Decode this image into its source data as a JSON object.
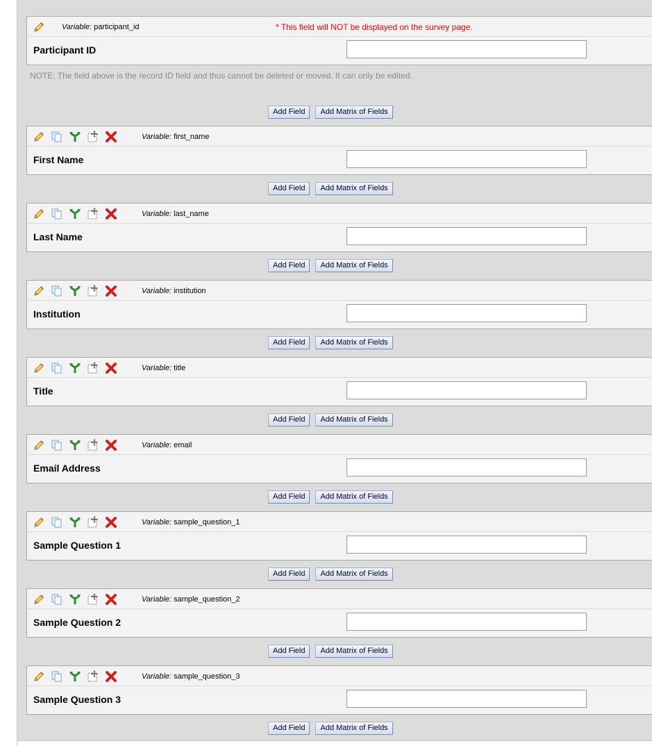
{
  "record_id_field": {
    "variable_prefix": "Variable:",
    "variable_name": "participant_id",
    "warning": "* This field will NOT be displayed on the survey page.",
    "label": "Participant ID",
    "value": ""
  },
  "note": "NOTE: The field above is the record ID field and thus cannot be deleted or moved. It can only be edited.",
  "buttons": {
    "add_field": "Add Field",
    "add_matrix": "Add Matrix of Fields"
  },
  "icons": [
    "pencil-icon",
    "copy-icon",
    "branching-icon",
    "move-icon",
    "delete-icon"
  ],
  "fields": [
    {
      "variable_prefix": "Variable:",
      "variable_name": "first_name",
      "label": "First Name",
      "value": ""
    },
    {
      "variable_prefix": "Variable:",
      "variable_name": "last_name",
      "label": "Last Name",
      "value": ""
    },
    {
      "variable_prefix": "Variable:",
      "variable_name": "institution",
      "label": "Institution",
      "value": ""
    },
    {
      "variable_prefix": "Variable:",
      "variable_name": "title",
      "label": "Title",
      "value": ""
    },
    {
      "variable_prefix": "Variable:",
      "variable_name": "email",
      "label": "Email Address",
      "value": ""
    },
    {
      "variable_prefix": "Variable:",
      "variable_name": "sample_question_1",
      "label": "Sample Question 1",
      "value": ""
    },
    {
      "variable_prefix": "Variable:",
      "variable_name": "sample_question_2",
      "label": "Sample Question 2",
      "value": ""
    },
    {
      "variable_prefix": "Variable:",
      "variable_name": "sample_question_3",
      "label": "Sample Question 3",
      "value": ""
    }
  ],
  "colors": {
    "warning": "#ff0000",
    "note": "#8a8a8a",
    "panel": "#f3f3f3",
    "background": "#dcdcdc",
    "button_border": "#6f8bb5"
  }
}
